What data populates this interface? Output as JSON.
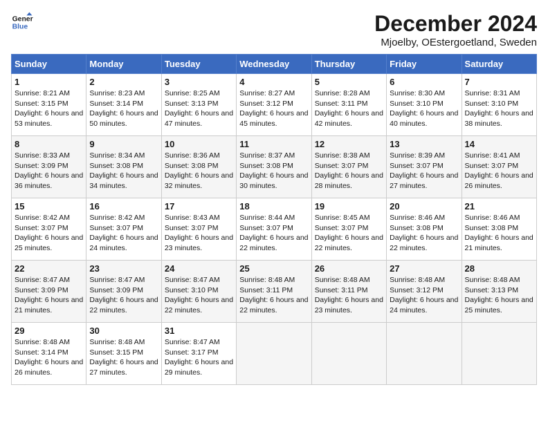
{
  "header": {
    "logo_text_top": "General",
    "logo_text_bottom": "Blue",
    "title": "December 2024",
    "subtitle": "Mjoelby, OEstergoetland, Sweden"
  },
  "calendar": {
    "days_of_week": [
      "Sunday",
      "Monday",
      "Tuesday",
      "Wednesday",
      "Thursday",
      "Friday",
      "Saturday"
    ],
    "weeks": [
      [
        {
          "day": "1",
          "sunrise": "8:21 AM",
          "sunset": "3:15 PM",
          "daylight": "6 hours and 53 minutes."
        },
        {
          "day": "2",
          "sunrise": "8:23 AM",
          "sunset": "3:14 PM",
          "daylight": "6 hours and 50 minutes."
        },
        {
          "day": "3",
          "sunrise": "8:25 AM",
          "sunset": "3:13 PM",
          "daylight": "6 hours and 47 minutes."
        },
        {
          "day": "4",
          "sunrise": "8:27 AM",
          "sunset": "3:12 PM",
          "daylight": "6 hours and 45 minutes."
        },
        {
          "day": "5",
          "sunrise": "8:28 AM",
          "sunset": "3:11 PM",
          "daylight": "6 hours and 42 minutes."
        },
        {
          "day": "6",
          "sunrise": "8:30 AM",
          "sunset": "3:10 PM",
          "daylight": "6 hours and 40 minutes."
        },
        {
          "day": "7",
          "sunrise": "8:31 AM",
          "sunset": "3:10 PM",
          "daylight": "6 hours and 38 minutes."
        }
      ],
      [
        {
          "day": "8",
          "sunrise": "8:33 AM",
          "sunset": "3:09 PM",
          "daylight": "6 hours and 36 minutes."
        },
        {
          "day": "9",
          "sunrise": "8:34 AM",
          "sunset": "3:08 PM",
          "daylight": "6 hours and 34 minutes."
        },
        {
          "day": "10",
          "sunrise": "8:36 AM",
          "sunset": "3:08 PM",
          "daylight": "6 hours and 32 minutes."
        },
        {
          "day": "11",
          "sunrise": "8:37 AM",
          "sunset": "3:08 PM",
          "daylight": "6 hours and 30 minutes."
        },
        {
          "day": "12",
          "sunrise": "8:38 AM",
          "sunset": "3:07 PM",
          "daylight": "6 hours and 28 minutes."
        },
        {
          "day": "13",
          "sunrise": "8:39 AM",
          "sunset": "3:07 PM",
          "daylight": "6 hours and 27 minutes."
        },
        {
          "day": "14",
          "sunrise": "8:41 AM",
          "sunset": "3:07 PM",
          "daylight": "6 hours and 26 minutes."
        }
      ],
      [
        {
          "day": "15",
          "sunrise": "8:42 AM",
          "sunset": "3:07 PM",
          "daylight": "6 hours and 25 minutes."
        },
        {
          "day": "16",
          "sunrise": "8:42 AM",
          "sunset": "3:07 PM",
          "daylight": "6 hours and 24 minutes."
        },
        {
          "day": "17",
          "sunrise": "8:43 AM",
          "sunset": "3:07 PM",
          "daylight": "6 hours and 23 minutes."
        },
        {
          "day": "18",
          "sunrise": "8:44 AM",
          "sunset": "3:07 PM",
          "daylight": "6 hours and 22 minutes."
        },
        {
          "day": "19",
          "sunrise": "8:45 AM",
          "sunset": "3:07 PM",
          "daylight": "6 hours and 22 minutes."
        },
        {
          "day": "20",
          "sunrise": "8:46 AM",
          "sunset": "3:08 PM",
          "daylight": "6 hours and 22 minutes."
        },
        {
          "day": "21",
          "sunrise": "8:46 AM",
          "sunset": "3:08 PM",
          "daylight": "6 hours and 21 minutes."
        }
      ],
      [
        {
          "day": "22",
          "sunrise": "8:47 AM",
          "sunset": "3:09 PM",
          "daylight": "6 hours and 21 minutes."
        },
        {
          "day": "23",
          "sunrise": "8:47 AM",
          "sunset": "3:09 PM",
          "daylight": "6 hours and 22 minutes."
        },
        {
          "day": "24",
          "sunrise": "8:47 AM",
          "sunset": "3:10 PM",
          "daylight": "6 hours and 22 minutes."
        },
        {
          "day": "25",
          "sunrise": "8:48 AM",
          "sunset": "3:11 PM",
          "daylight": "6 hours and 22 minutes."
        },
        {
          "day": "26",
          "sunrise": "8:48 AM",
          "sunset": "3:11 PM",
          "daylight": "6 hours and 23 minutes."
        },
        {
          "day": "27",
          "sunrise": "8:48 AM",
          "sunset": "3:12 PM",
          "daylight": "6 hours and 24 minutes."
        },
        {
          "day": "28",
          "sunrise": "8:48 AM",
          "sunset": "3:13 PM",
          "daylight": "6 hours and 25 minutes."
        }
      ],
      [
        {
          "day": "29",
          "sunrise": "8:48 AM",
          "sunset": "3:14 PM",
          "daylight": "6 hours and 26 minutes."
        },
        {
          "day": "30",
          "sunrise": "8:48 AM",
          "sunset": "3:15 PM",
          "daylight": "6 hours and 27 minutes."
        },
        {
          "day": "31",
          "sunrise": "8:47 AM",
          "sunset": "3:17 PM",
          "daylight": "6 hours and 29 minutes."
        },
        null,
        null,
        null,
        null
      ]
    ]
  }
}
